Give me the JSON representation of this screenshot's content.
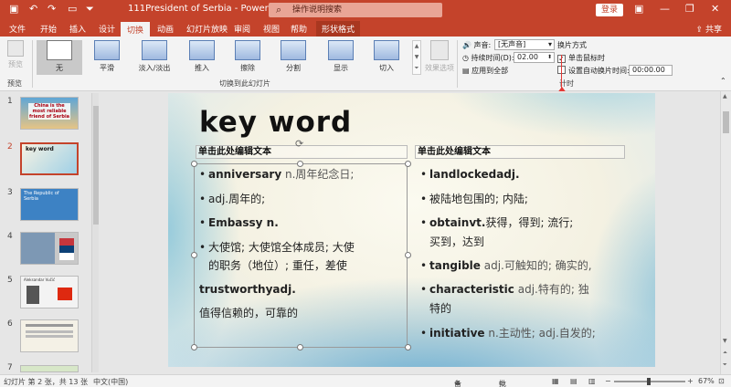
{
  "titlebar": {
    "document_title": "111President of Serbia  -  PowerPoint",
    "search_placeholder": "操作说明搜索",
    "login_label": "登录",
    "qa_save_icon": "save-icon",
    "qa_undo_icon": "undo-icon",
    "qa_redo_icon": "redo-icon",
    "qa_present_icon": "present-icon"
  },
  "tabs": {
    "file": "文件",
    "home": "开始",
    "insert": "插入",
    "design": "设计",
    "transitions": "切换",
    "animations": "动画",
    "slideshow": "幻灯片放映",
    "review": "审阅",
    "view": "视图",
    "help": "帮助",
    "shape_format": "形状格式",
    "share": "共享"
  },
  "ribbon": {
    "preview_label": "预览",
    "preview_group": "预览",
    "transitions": [
      "无",
      "平滑",
      "淡入/淡出",
      "推入",
      "擦除",
      "分割",
      "显示",
      "切入"
    ],
    "effect_options": "效果选项",
    "transition_group_label": "切换到此幻灯片",
    "sound_label": "声音:",
    "sound_value": "[无声音]",
    "duration_label": "持续时间(D):",
    "duration_value": "02.00",
    "apply_all": "应用到全部",
    "advance_heading": "换片方式",
    "on_click": "单击鼠标时",
    "after_time": "设置自动换片时间:",
    "after_time_value": "00:00.00",
    "timing_group_label": "计时"
  },
  "thumbnails": [
    {
      "num": "1",
      "text": "China is the most reliable friend of Serbia"
    },
    {
      "num": "2",
      "text": "key word"
    },
    {
      "num": "3",
      "text": "The Republic of Serbia"
    },
    {
      "num": "4",
      "text": ""
    },
    {
      "num": "5",
      "text": "Aleksandar Vučić"
    },
    {
      "num": "6",
      "text": ""
    },
    {
      "num": "7",
      "text": ""
    }
  ],
  "slide": {
    "title": "key  word",
    "left_header": "单击此处编辑文本",
    "right_header": "单击此处编辑文本",
    "left": {
      "b1_bold": "anniversary",
      "b1_rest": "n.周年纪念日;",
      "b2": "adj.周年的;",
      "b3": "Embassy n.",
      "b4_line1": "大使馆;  大使馆全体成员;  大使",
      "b4_line2": "的职务（地位）;  重任，差使",
      "p5": "trustworthyadj.",
      "p6": "值得信赖的，可靠的"
    },
    "right": {
      "b1": "landlockedadj.",
      "b2": "被陆地包围的;  内陆;",
      "b3_bold": "obtainvt.",
      "b3_rest": "获得，得到;  流行;",
      "b3_line2": "买到，达到",
      "b4_bold": "tangible",
      "b4_rest": "adj.可触知的;  确实的,",
      "b5_bold": "characteristic",
      "b5_rest": "adj.特有的;  独",
      "b5_line2": "特的",
      "b6_bold": "initiative",
      "b6_rest": "n.主动性; adj.自发的;"
    }
  },
  "status": {
    "slide_count": "幻灯片 第 2 张，共 13 张",
    "language": "中文(中国)",
    "notes": "备注",
    "comments": "批注",
    "zoom": "67%"
  }
}
